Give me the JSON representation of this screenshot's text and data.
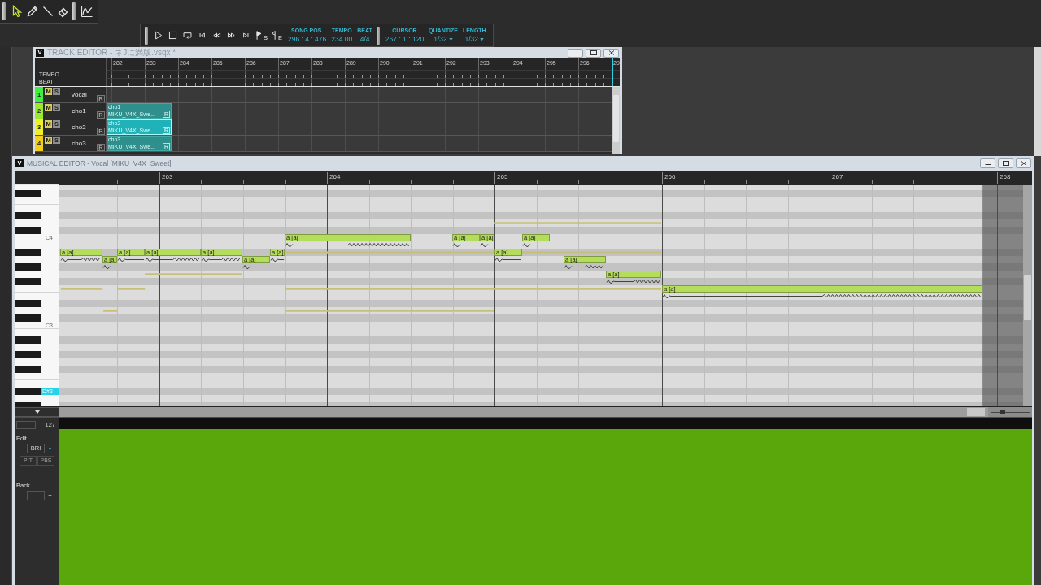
{
  "toolbar": {
    "tools": [
      {
        "kind": "arrow",
        "selected": true
      },
      {
        "kind": "pencil",
        "selected": false
      },
      {
        "kind": "line",
        "selected": false
      },
      {
        "kind": "eraser",
        "selected": false
      }
    ],
    "tools_2": [
      {
        "kind": "curve",
        "selected": false
      }
    ]
  },
  "transport": {
    "buttons": [
      {
        "kind": "play"
      },
      {
        "kind": "stop"
      },
      {
        "kind": "loop"
      },
      {
        "kind": "first"
      },
      {
        "kind": "rewind"
      },
      {
        "kind": "forward"
      },
      {
        "kind": "last"
      },
      {
        "kind": "flag_start",
        "sub": "S"
      },
      {
        "kind": "flag_end",
        "sub": "E"
      }
    ],
    "readouts": [
      {
        "label": "SONG POS.",
        "value": "296 : 4 : 476",
        "kind": "text"
      },
      {
        "label": "TEMPO",
        "value": "234.00",
        "kind": "text"
      },
      {
        "label": "BEAT",
        "value": "4/4",
        "kind": "text"
      }
    ],
    "readouts_2": [
      {
        "label": "CURSOR",
        "value": "267 : 1 : 120",
        "kind": "text"
      },
      {
        "label": "QUANTIZE",
        "value": "1/32",
        "kind": "dropdown"
      },
      {
        "label": "LENGTH",
        "value": "1/32",
        "kind": "dropdown"
      }
    ]
  },
  "track_editor": {
    "icon": "V",
    "title": "TRACK EDITOR - ネJに満版.vsqx *",
    "row_labels": [
      "TEMPO",
      "BEAT"
    ],
    "measures": [
      "282",
      "283",
      "284",
      "285",
      "286",
      "287",
      "288",
      "289",
      "290",
      "291",
      "292",
      "293",
      "294",
      "295",
      "296",
      "29"
    ],
    "tracks": [
      {
        "number": "1",
        "color": "#3cf03c",
        "mute": "M",
        "solo": "S",
        "name": "Vocal",
        "record": "R"
      },
      {
        "number": "2",
        "color": "#9be82c",
        "mute": "M",
        "solo": "S",
        "name": "cho1",
        "record": "R",
        "part": {
          "name": "cho1",
          "singer": "MIKU_V4X_Swe...",
          "badge": "R",
          "selected": false
        }
      },
      {
        "number": "3",
        "color": "#eef02a",
        "mute": "M",
        "solo": "S",
        "name": "cho2",
        "record": "R",
        "part": {
          "name": "cho2",
          "singer": "MIKU_V4X_Swe...",
          "badge": "R",
          "selected": true
        }
      },
      {
        "number": "4",
        "color": "#f2cf1e",
        "mute": "M",
        "solo": "S",
        "name": "cho3",
        "record": "R",
        "part": {
          "name": "cho3",
          "singer": "MIKU_V4X_Swe...",
          "badge": "R",
          "selected": false
        }
      }
    ]
  },
  "musical_editor": {
    "icon": "V",
    "title": "MUSICAL EDITOR - Vocal [MIKU_V4X_Sweet]",
    "piano_roll": {
      "measures": [
        "263",
        "264",
        "265",
        "266",
        "267",
        "268"
      ],
      "key_labels": [
        {
          "label": "C4",
          "selected": false
        },
        {
          "label": "C3",
          "selected": false
        },
        {
          "label": "D#2",
          "selected": true
        }
      ],
      "notes": [
        {
          "lyric": "a [a]",
          "vibrato": true
        },
        {
          "lyric": "a [a]",
          "vibrato": false
        },
        {
          "lyric": "a [a]",
          "vibrato": false
        },
        {
          "lyric": "a [a]",
          "vibrato": true
        },
        {
          "lyric": "a [a]",
          "vibrato": true
        },
        {
          "lyric": "a [a]",
          "vibrato": false
        },
        {
          "lyric": "a [a]",
          "vibrato": false
        },
        {
          "lyric": "a [a]",
          "vibrato": true
        },
        {
          "lyric": "a [a]",
          "vibrato": false
        },
        {
          "lyric": "a [a]",
          "vibrato": false
        },
        {
          "lyric": "a [a]",
          "vibrato": false
        },
        {
          "lyric": "a [a]",
          "vibrato": false
        },
        {
          "lyric": "a [a]",
          "vibrato": true
        },
        {
          "lyric": "a [a]",
          "vibrato": true
        },
        {
          "lyric": "a [a]",
          "vibrato": true
        }
      ]
    },
    "zoom_slider": {
      "level": 0.3
    },
    "parameter_panel": {
      "max": "127",
      "edit_label": "Edit",
      "curve": "BRI",
      "buttons": [
        "PIT",
        "PBS"
      ],
      "back_label": "Back",
      "back_curve": "-"
    }
  }
}
